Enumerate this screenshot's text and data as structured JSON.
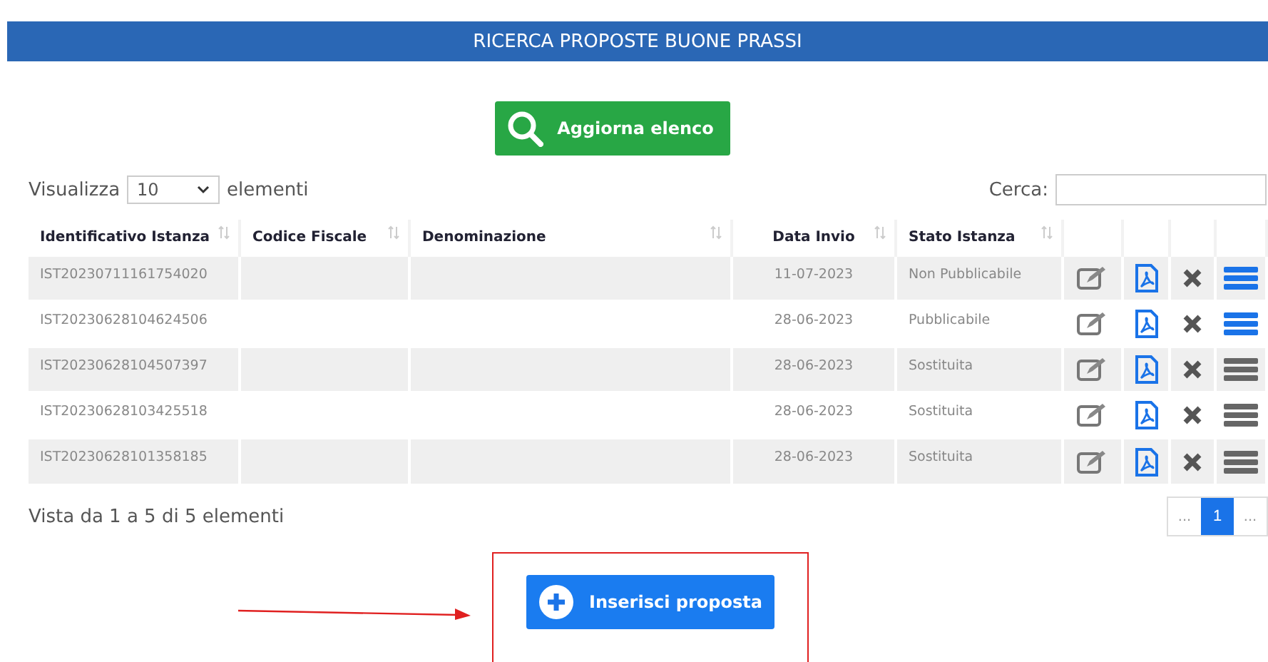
{
  "header": {
    "title": "RICERCA PROPOSTE BUONE PRASSI"
  },
  "refresh_button": {
    "label": "Aggiorna elenco"
  },
  "length": {
    "prefix": "Visualizza",
    "value": "10",
    "suffix": "elementi"
  },
  "search": {
    "label": "Cerca:"
  },
  "table": {
    "columns": [
      "Identificativo Istanza",
      "Codice Fiscale",
      "Denominazione",
      "Data Invio",
      "Stato Istanza"
    ],
    "rows": [
      {
        "id": "IST20230711161754020",
        "date": "11-07-2023",
        "status": "Non Pubblicabile",
        "details_enabled": true
      },
      {
        "id": "IST20230628104624506",
        "date": "28-06-2023",
        "status": "Pubblicabile",
        "details_enabled": true
      },
      {
        "id": "IST20230628104507397",
        "date": "28-06-2023",
        "status": "Sostituita",
        "details_enabled": false
      },
      {
        "id": "IST20230628103425518",
        "date": "28-06-2023",
        "status": "Sostituita",
        "details_enabled": false
      },
      {
        "id": "IST20230628101358185",
        "date": "28-06-2023",
        "status": "Sostituita",
        "details_enabled": false
      }
    ]
  },
  "info": "Vista da 1 a 5 di 5 elementi",
  "pagination": [
    {
      "label": "...",
      "selected": false
    },
    {
      "label": "1",
      "selected": true
    },
    {
      "label": "...",
      "selected": false
    }
  ],
  "add_button": {
    "label": "Inserisci proposta"
  }
}
